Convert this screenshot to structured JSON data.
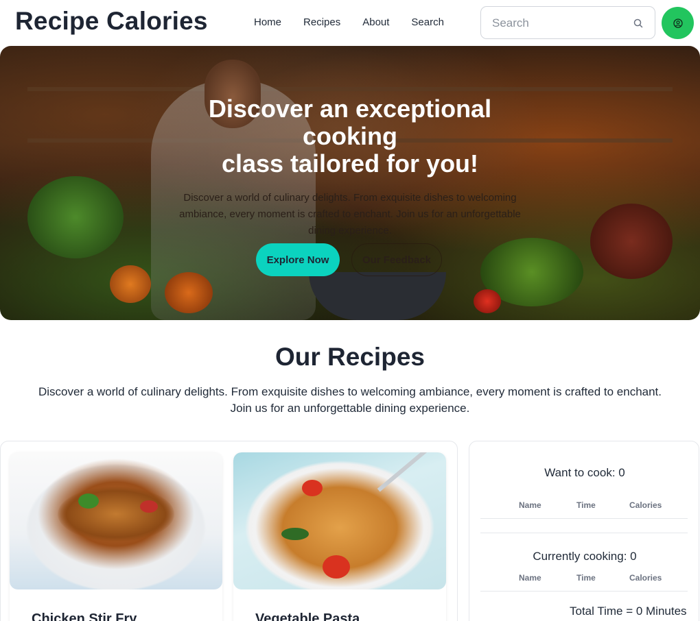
{
  "navbar": {
    "brand": "Recipe Calories",
    "links": [
      "Home",
      "Recipes",
      "About",
      "Search"
    ],
    "search_placeholder": "Search",
    "profile_color": "#22c55e"
  },
  "hero": {
    "title_line1": "Discover an exceptional",
    "title_line2": "cooking",
    "title_line3": "class tailored for you!",
    "description": "Discover a world of culinary delights. From exquisite dishes to welcoming ambiance, every moment is crafted to enchant. Join us for an unforgettable dining experience.",
    "primary_button": "Explore Now",
    "secondary_button": "Our Feedback",
    "accent_color": "#0bd3bf"
  },
  "recipes_section": {
    "title": "Our Recipes",
    "description_line1": "Discover a world of culinary delights. From exquisite dishes to welcoming ambiance, every moment is crafted to enchant.",
    "description_line2": "Join us for an unforgettable dining experience.",
    "cards": [
      {
        "title": "Chicken Stir Fry"
      },
      {
        "title": "Vegetable Pasta"
      }
    ]
  },
  "sidebar": {
    "want_to_cook": "Want to cook: 0",
    "currently_cooking": "Currently cooking: 0",
    "columns": [
      "Name",
      "Time",
      "Calories"
    ],
    "total_time": "Total Time = 0 Minutes"
  }
}
